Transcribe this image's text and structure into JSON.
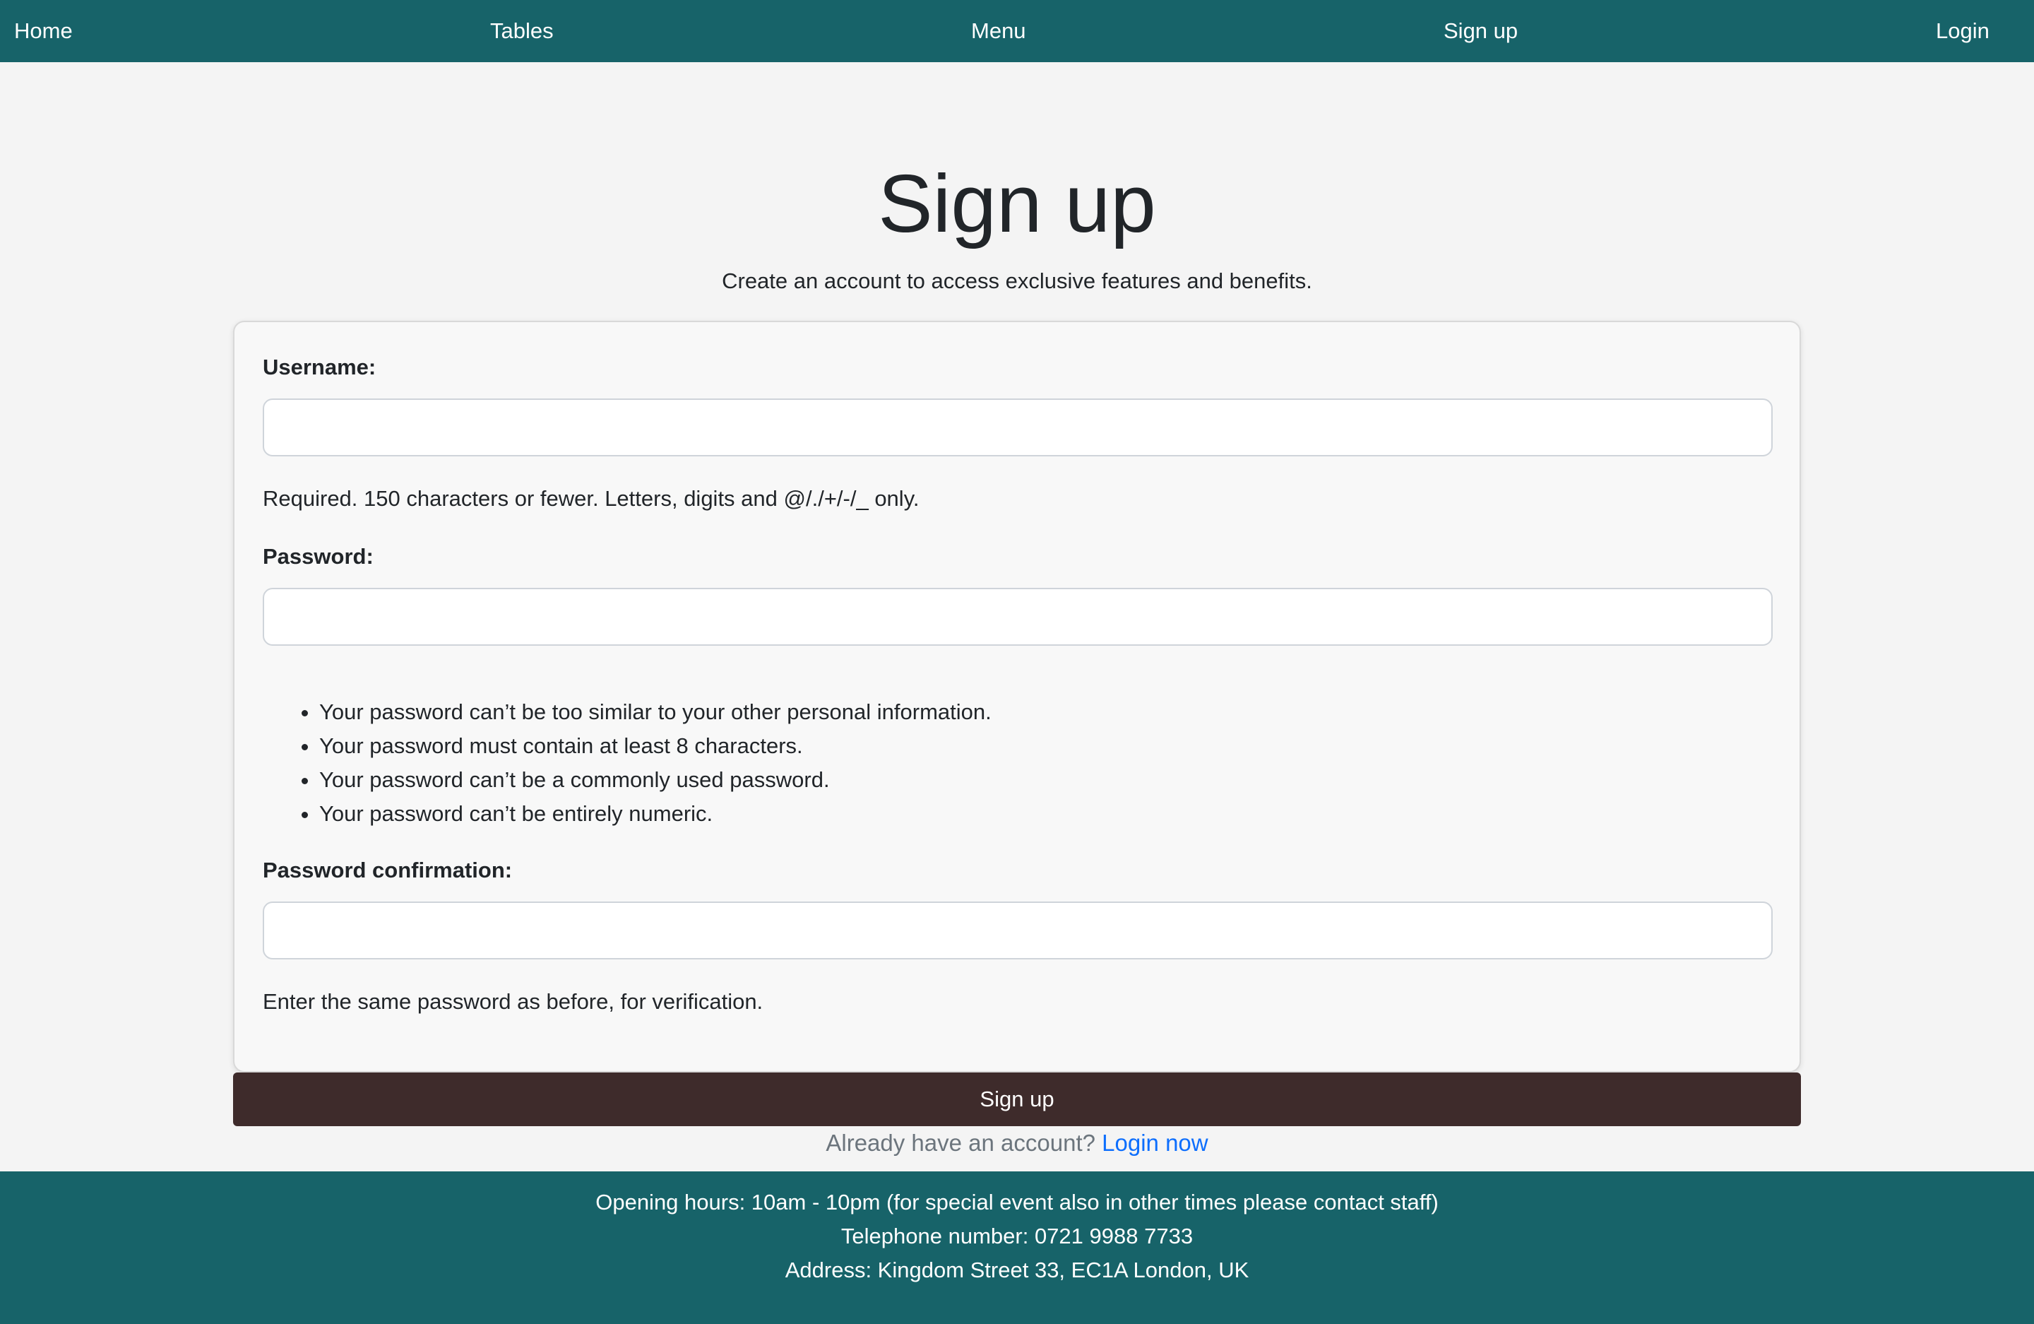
{
  "nav": {
    "home": "Home",
    "tables": "Tables",
    "menu": "Menu",
    "signup": "Sign up",
    "login": "Login"
  },
  "header": {
    "title": "Sign up",
    "subtitle": "Create an account to access exclusive features and benefits."
  },
  "form": {
    "username": {
      "label": "Username:",
      "value": "",
      "help": "Required. 150 characters or fewer. Letters, digits and @/./+/-/_ only."
    },
    "password": {
      "label": "Password:",
      "value": "",
      "rules": [
        "Your password can’t be too similar to your other personal information.",
        "Your password must contain at least 8 characters.",
        "Your password can’t be a commonly used password.",
        "Your password can’t be entirely numeric."
      ]
    },
    "password_confirmation": {
      "label": "Password confirmation:",
      "value": "",
      "help": "Enter the same password as before, for verification."
    },
    "submit_label": "Sign up"
  },
  "login_prompt": {
    "text": "Already have an account?",
    "link": "Login now"
  },
  "footer": {
    "hours": "Opening hours: 10am - 10pm (for special event also in other times please contact staff)",
    "telephone": "Telephone number: 0721 9988 7733",
    "address": "Address: Kingdom Street 33, EC1A London, UK"
  },
  "colors": {
    "nav_background": "#176369",
    "page_background": "#f4f4f4",
    "button_background": "#3e2b2b",
    "link": "#0d6efd"
  }
}
